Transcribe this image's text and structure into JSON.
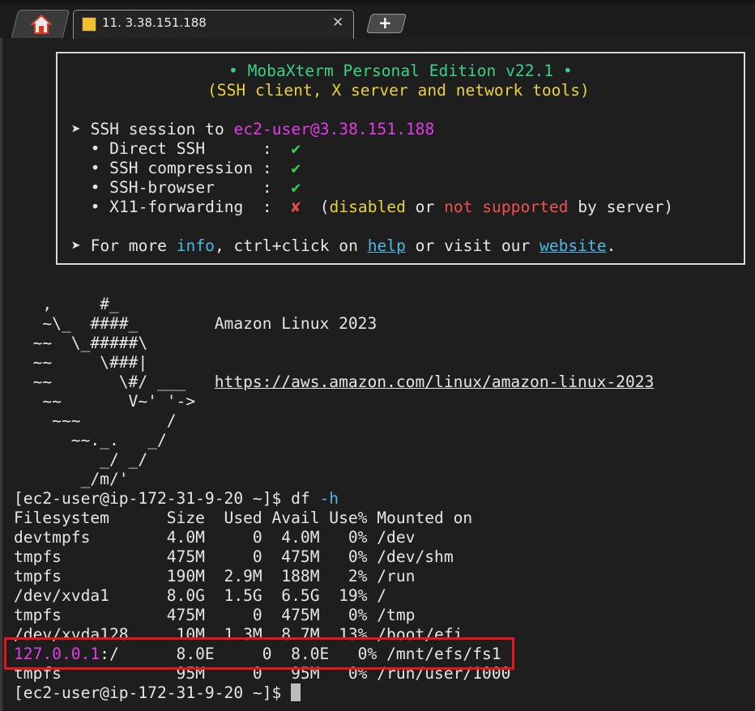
{
  "tabs": {
    "session_title": "11. 3.38.151.188"
  },
  "banner": {
    "title": "• MobaXterm Personal Edition v22.1 •",
    "subtitle": "(SSH client, X server and network tools)",
    "session_prefix": "➤ SSH session to ",
    "session_target": "ec2-user@3.38.151.188",
    "features": [
      {
        "label": "  • Direct SSH      :  ",
        "mark": "✔"
      },
      {
        "label": "  • SSH compression :  ",
        "mark": "✔"
      },
      {
        "label": "  • SSH-browser     :  ",
        "mark": "✔"
      },
      {
        "label": "  • X11-forwarding  :  ",
        "mark": "✘"
      }
    ],
    "x11_note": {
      "open": "  (",
      "disabled": "disabled",
      "or": " or ",
      "not_supported": "not supported",
      "tail": " by server)"
    },
    "more": {
      "prefix": "➤ For more ",
      "info": "info",
      "mid": ", ctrl+click on ",
      "help": "help",
      "mid2": " or visit our ",
      "website": "website",
      "end": "."
    }
  },
  "ascii_art": [
    "   ,     #_",
    "   ~\\_  ####_        Amazon Linux 2023",
    "  ~~  \\_#####\\",
    "  ~~     \\###|",
    "  ~~       \\#/ ___   ",
    "   ~~       V~' '->",
    "    ~~~         /",
    "      ~~._.   _/",
    "         _/ _/",
    "       _/m/'"
  ],
  "amazon_url": "https://aws.amazon.com/linux/amazon-linux-2023",
  "prompt": "[ec2-user@ip-172-31-9-20 ~]$ ",
  "command": "df ",
  "command_flag": "-h",
  "df_header": "Filesystem      Size  Used Avail Use% Mounted on",
  "df_rows": [
    "devtmpfs        4.0M     0  4.0M   0% /dev",
    "tmpfs           475M     0  475M   0% /dev/shm",
    "tmpfs           190M  2.9M  188M   2% /run",
    "/dev/xvda1      8.0G  1.5G  6.5G  19% /",
    "tmpfs           475M     0  475M   0% /tmp",
    "/dev/xvda128     10M  1.3M  8.7M  13% /boot/efi"
  ],
  "efs_row": {
    "ip": "127.0.0.1",
    "rest": ":/      8.0E     0  8.0E   0% /mnt/efs/fs1"
  },
  "last_row": "tmpfs            95M     0   95M   0% /run/user/1000",
  "final_prompt": "[ec2-user@ip-172-31-9-20 ~]$ "
}
